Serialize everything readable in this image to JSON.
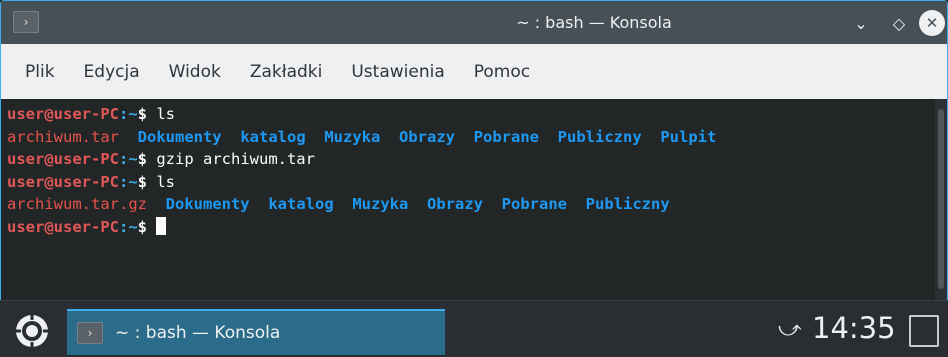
{
  "window": {
    "title": "~ : bash — Konsola",
    "app_icon_glyph": "›",
    "buttons": {
      "minimize_glyph": "⌄",
      "maximize_glyph": "◇",
      "close_glyph": "✕"
    }
  },
  "menubar": {
    "items": [
      "Plik",
      "Edycja",
      "Widok",
      "Zakładki",
      "Ustawienia",
      "Pomoc"
    ]
  },
  "terminal": {
    "prompt": {
      "user": "user@user-PC",
      "path": ":~",
      "dollar": "$"
    },
    "lines": [
      {
        "type": "command",
        "command": " ls"
      },
      {
        "type": "listing",
        "items": [
          {
            "name": "archiwum.tar",
            "kind": "archive"
          },
          {
            "name": "Dokumenty",
            "kind": "dir"
          },
          {
            "name": "katalog",
            "kind": "dir"
          },
          {
            "name": "Muzyka",
            "kind": "dir"
          },
          {
            "name": "Obrazy",
            "kind": "dir"
          },
          {
            "name": "Pobrane",
            "kind": "dir"
          },
          {
            "name": "Publiczny",
            "kind": "dir"
          },
          {
            "name": "Pulpit",
            "kind": "dir"
          }
        ]
      },
      {
        "type": "command",
        "command": " gzip archiwum.tar"
      },
      {
        "type": "command",
        "command": " ls"
      },
      {
        "type": "listing",
        "items": [
          {
            "name": "archiwum.tar.gz",
            "kind": "archive"
          },
          {
            "name": "Dokumenty",
            "kind": "dir"
          },
          {
            "name": "katalog",
            "kind": "dir"
          },
          {
            "name": "Muzyka",
            "kind": "dir"
          },
          {
            "name": "Obrazy",
            "kind": "dir"
          },
          {
            "name": "Pobrane",
            "kind": "dir"
          },
          {
            "name": "Publiczny",
            "kind": "dir"
          }
        ]
      },
      {
        "type": "prompt"
      }
    ]
  },
  "taskbar": {
    "task_label": "~ : bash — Konsola",
    "task_icon_glyph": "›",
    "network_glyph": "⤻",
    "clock": "14:35"
  },
  "colors": {
    "accent": "#3daee9",
    "prompt_user": "#e05757",
    "archive": "#e5534b",
    "directory": "#1d99f3",
    "terminal_bg": "#232627",
    "titlebar_bg": "#475057",
    "menubar_bg": "#eff0f1"
  }
}
